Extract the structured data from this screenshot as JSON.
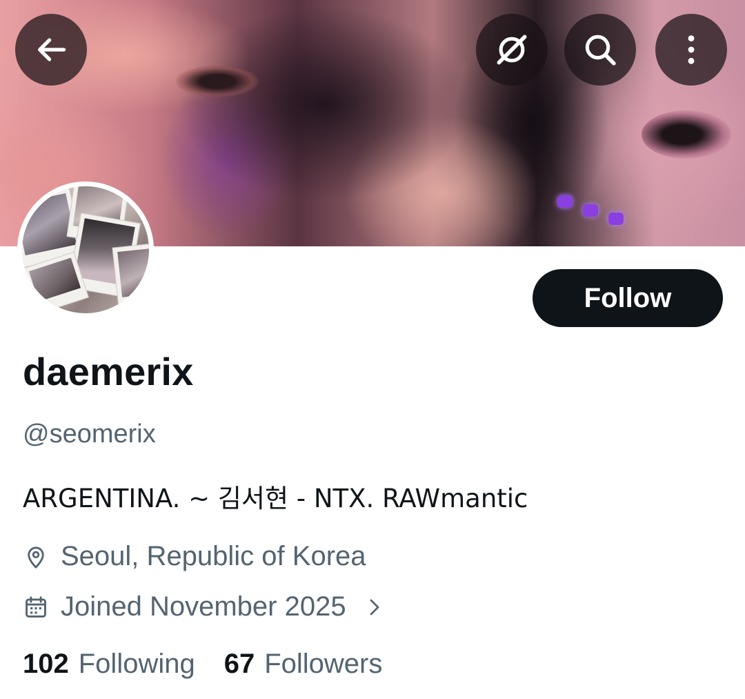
{
  "header": {
    "back_icon": "arrow-left-icon",
    "grok_icon": "grok-icon",
    "search_icon": "search-icon",
    "more_icon": "more-vertical-icon"
  },
  "profile": {
    "follow_label": "Follow",
    "display_name": "daemerix",
    "handle": "@seomerix",
    "bio": "ARGENTINA. ~ 김서현 - NTX. RAWmantic",
    "location": "Seoul, Republic of Korea",
    "joined": "Joined November 2025",
    "following_count": "102",
    "following_label": "Following",
    "followers_count": "67",
    "followers_label": "Followers"
  },
  "colors": {
    "text_primary": "#0f1419",
    "text_secondary": "#536471",
    "follow_bg": "#0f1419"
  }
}
